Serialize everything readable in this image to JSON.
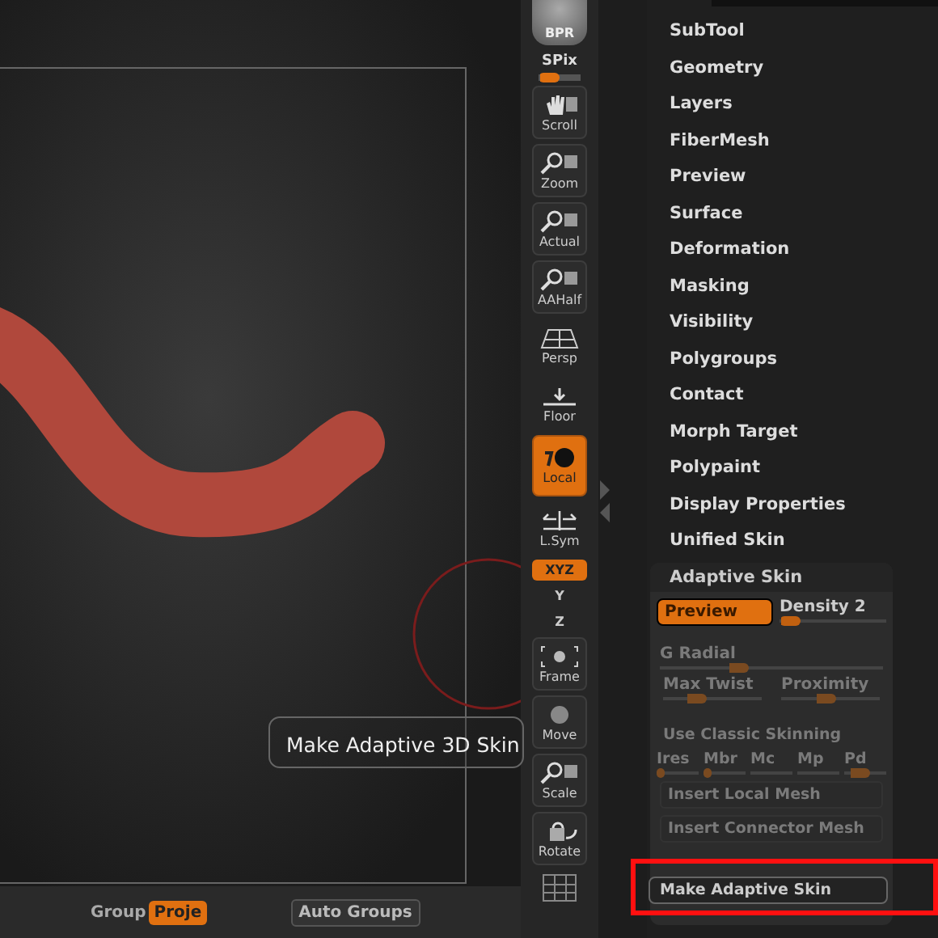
{
  "shelf": {
    "top": {
      "label": "BPR"
    },
    "spix": {
      "label": "SPix",
      "level": 0.5
    },
    "buttons": [
      {
        "label": "Scroll",
        "kind": "hand",
        "on": false
      },
      {
        "label": "Zoom",
        "kind": "magnifier",
        "on": false
      },
      {
        "label": "Actual",
        "kind": "magnifier",
        "on": false
      },
      {
        "label": "AAHalf",
        "kind": "magnifier",
        "on": false
      },
      {
        "label": "Persp",
        "kind": "grid",
        "on": false
      },
      {
        "label": "Floor",
        "kind": "floor",
        "on": false
      },
      {
        "label": "Local",
        "kind": "local",
        "on": true
      },
      {
        "label": "L.Sym",
        "kind": "sym",
        "on": false
      },
      {
        "label": "XYZ",
        "kind": "axis",
        "on": true
      },
      {
        "label": "Y",
        "kind": "axis",
        "on": false
      },
      {
        "label": "Z",
        "kind": "axis",
        "on": false
      },
      {
        "label": "Frame",
        "kind": "frame",
        "on": false
      },
      {
        "label": "Move",
        "kind": "move",
        "on": false
      },
      {
        "label": "Scale",
        "kind": "magnifier",
        "on": false
      },
      {
        "label": "Rotate",
        "kind": "rotate",
        "on": false
      }
    ]
  },
  "tooltip": "Make Adaptive 3D Skin",
  "bottom_bar": {
    "group_label": "Group",
    "group_button": {
      "label": "Proje",
      "on": true
    },
    "auto_groups": "Auto Groups"
  },
  "menu": [
    "SubTool",
    "Geometry",
    "Layers",
    "FiberMesh",
    "Preview",
    "Surface",
    "Deformation",
    "Masking",
    "Visibility",
    "Polygroups",
    "Contact",
    "Morph Target",
    "Polypaint",
    "Display Properties",
    "Unified Skin"
  ],
  "adaptive_skin": {
    "title": "Adaptive Skin",
    "preview": {
      "label": "Preview",
      "on": true
    },
    "density": {
      "label": "Density 2",
      "level": 0.2,
      "disabled": false
    },
    "g_radial": {
      "label": "G Radial",
      "level": 0.4,
      "disabled": true
    },
    "twist_row": [
      {
        "label": "Max Twist",
        "level": 0.45,
        "disabled": true
      },
      {
        "label": "Proximity",
        "level": 0.55,
        "disabled": true
      }
    ],
    "classic": {
      "label": "Use Classic Skinning",
      "disabled": true
    },
    "small_sliders": [
      {
        "label": "Ires",
        "level": 0.2,
        "disabled": true
      },
      {
        "label": "Mbr",
        "level": 0.2,
        "disabled": true
      },
      {
        "label": "Mc",
        "disabled": true
      },
      {
        "label": "Mp",
        "disabled": true
      },
      {
        "label": "Pd",
        "level": 0.6,
        "disabled": true
      }
    ],
    "insert_buttons": [
      {
        "label": "Insert Local Mesh",
        "disabled": true
      },
      {
        "label": "Insert Connector Mesh",
        "disabled": true
      }
    ],
    "make_button": {
      "label": "Make Adaptive Skin",
      "highlighted": true
    }
  }
}
